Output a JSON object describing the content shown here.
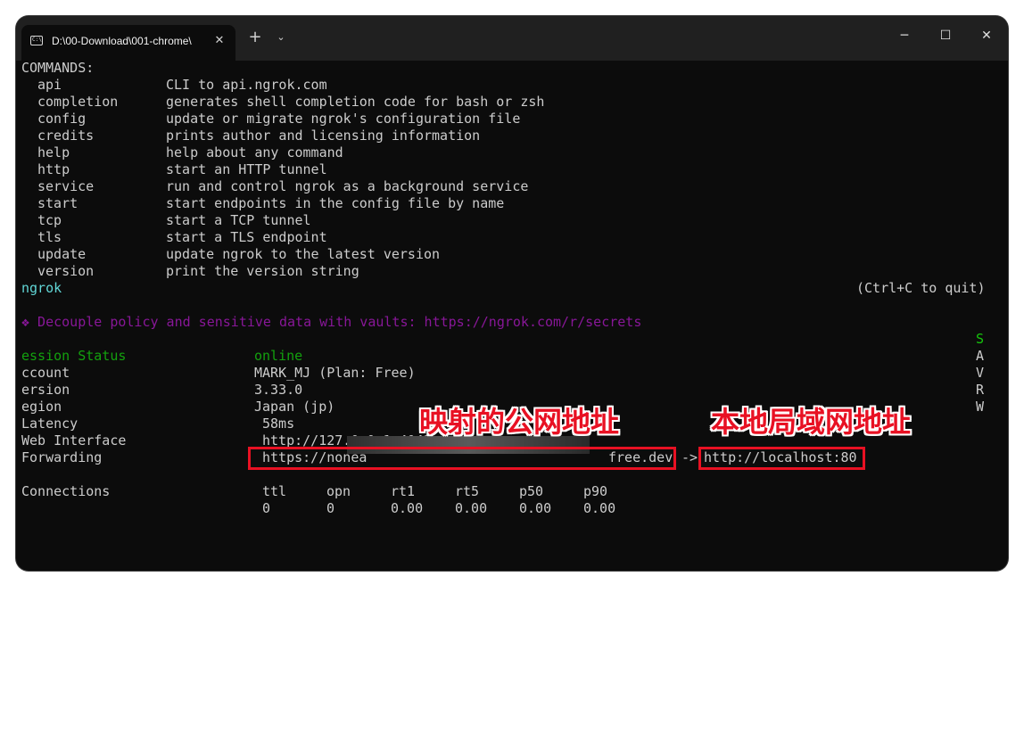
{
  "window": {
    "tab_title": "D:\\00-Download\\001-chrome\\",
    "tab_icon": "terminal-icon",
    "close_tab_glyph": "✕",
    "new_tab_glyph": "+",
    "dropdown_glyph": "⌄",
    "minimize_glyph": "─",
    "maximize_glyph": "☐",
    "close_glyph": "✕"
  },
  "terminal": {
    "commands_header": "COMMANDS:",
    "commands": [
      {
        "name": "api",
        "desc": "CLI to api.ngrok.com"
      },
      {
        "name": "completion",
        "desc": "generates shell completion code for bash or zsh"
      },
      {
        "name": "config",
        "desc": "update or migrate ngrok's configuration file"
      },
      {
        "name": "credits",
        "desc": "prints author and licensing information"
      },
      {
        "name": "help",
        "desc": "help about any command"
      },
      {
        "name": "http",
        "desc": "start an HTTP tunnel"
      },
      {
        "name": "service",
        "desc": "run and control ngrok as a background service"
      },
      {
        "name": "start",
        "desc": "start endpoints in the config file by name"
      },
      {
        "name": "tcp",
        "desc": "start a TCP tunnel"
      },
      {
        "name": "tls",
        "desc": "start a TLS endpoint"
      },
      {
        "name": "update",
        "desc": "update ngrok to the latest version"
      },
      {
        "name": "version",
        "desc": "print the version string"
      }
    ],
    "ngrok_label": "ngrok",
    "quit_hint": "(Ctrl+C to quit)",
    "promo": "❖ Decouple policy and sensitive data with vaults: https://ngrok.com/r/secrets",
    "side_letters": [
      "S",
      "A",
      "V",
      "R",
      "W"
    ],
    "status": {
      "session_status_label": "ession Status",
      "session_status_value": "online",
      "account_label": "ccount",
      "account_value": "MARK_MJ (Plan: Free)",
      "version_label": "ersion",
      "version_value": "3.33.0",
      "region_label": "egion",
      "region_value": "Japan (jp)",
      "latency_label": "Latency",
      "latency_value": "58ms",
      "web_interface_label": "Web Interface",
      "web_interface_value": "http://127.0.0.1:4042",
      "forwarding_label": "Forwarding",
      "forwarding_public_start": "https://nonea",
      "forwarding_public_end": "free.dev",
      "forwarding_arrow": "->",
      "forwarding_local": "http://localhost:80"
    },
    "connections": {
      "label": "Connections",
      "headers": [
        "ttl",
        "opn",
        "rt1",
        "rt5",
        "p50",
        "p90"
      ],
      "values": [
        "0",
        "0",
        "0.00",
        "0.00",
        "0.00",
        "0.00"
      ]
    }
  },
  "annotations": {
    "public_address": "映射的公网地址",
    "local_address": "本地局域网地址",
    "color": "#e81123"
  }
}
